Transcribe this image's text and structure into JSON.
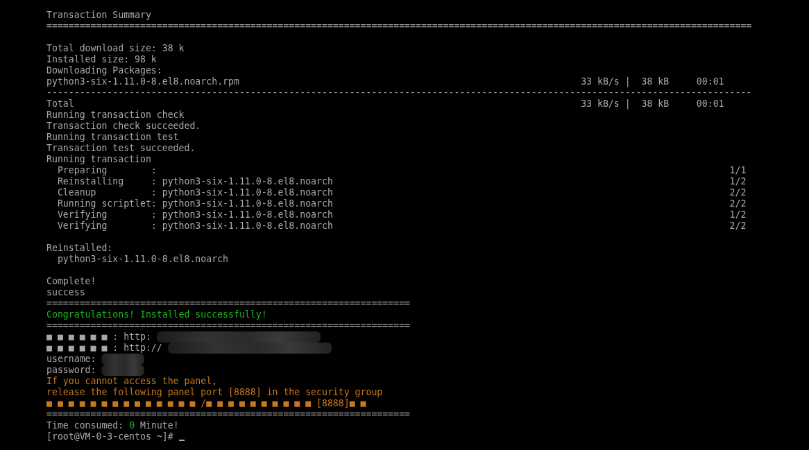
{
  "terminal": {
    "lines": [
      {
        "kind": "output",
        "segments": [
          {
            "kind": "text",
            "text": "Transaction Summary",
            "color": "#a8a8a8"
          }
        ]
      },
      {
        "kind": "output",
        "segments": [
          {
            "kind": "text",
            "text": "================================================================================================================================",
            "color": "#a8a8a8"
          }
        ]
      },
      {
        "kind": "blank"
      },
      {
        "kind": "output",
        "segments": [
          {
            "kind": "text",
            "text": "Total download size: 38 k",
            "color": "#a8a8a8"
          }
        ]
      },
      {
        "kind": "output",
        "segments": [
          {
            "kind": "text",
            "text": "Installed size: 98 k",
            "color": "#a8a8a8"
          }
        ]
      },
      {
        "kind": "output",
        "segments": [
          {
            "kind": "text",
            "text": "Downloading Packages:",
            "color": "#a8a8a8"
          }
        ]
      },
      {
        "kind": "output",
        "segments": [
          {
            "kind": "text",
            "text": "python3-six-1.11.0-8.el8.noarch.rpm                                                              33 kB/s |  38 kB     00:01",
            "color": "#a8a8a8"
          }
        ]
      },
      {
        "kind": "output",
        "segments": [
          {
            "kind": "text",
            "text": "--------------------------------------------------------------------------------------------------------------------------------",
            "color": "#a8a8a8"
          }
        ]
      },
      {
        "kind": "output",
        "segments": [
          {
            "kind": "text",
            "text": "Total                                                                                            33 kB/s |  38 kB     00:01",
            "color": "#a8a8a8"
          }
        ]
      },
      {
        "kind": "output",
        "segments": [
          {
            "kind": "text",
            "text": "Running transaction check",
            "color": "#a8a8a8"
          }
        ]
      },
      {
        "kind": "output",
        "segments": [
          {
            "kind": "text",
            "text": "Transaction check succeeded.",
            "color": "#a8a8a8"
          }
        ]
      },
      {
        "kind": "output",
        "segments": [
          {
            "kind": "text",
            "text": "Running transaction test",
            "color": "#a8a8a8"
          }
        ]
      },
      {
        "kind": "output",
        "segments": [
          {
            "kind": "text",
            "text": "Transaction test succeeded.",
            "color": "#a8a8a8"
          }
        ]
      },
      {
        "kind": "output",
        "segments": [
          {
            "kind": "text",
            "text": "Running transaction",
            "color": "#a8a8a8"
          }
        ]
      },
      {
        "kind": "output",
        "segments": [
          {
            "kind": "text",
            "text": "  Preparing        :                                                                                                        1/1",
            "color": "#a8a8a8"
          }
        ]
      },
      {
        "kind": "output",
        "segments": [
          {
            "kind": "text",
            "text": "  Reinstalling     : python3-six-1.11.0-8.el8.noarch                                                                        1/2",
            "color": "#a8a8a8"
          }
        ]
      },
      {
        "kind": "output",
        "segments": [
          {
            "kind": "text",
            "text": "  Cleanup          : python3-six-1.11.0-8.el8.noarch                                                                        2/2",
            "color": "#a8a8a8"
          }
        ]
      },
      {
        "kind": "output",
        "segments": [
          {
            "kind": "text",
            "text": "  Running scriptlet: python3-six-1.11.0-8.el8.noarch                                                                        2/2",
            "color": "#a8a8a8"
          }
        ]
      },
      {
        "kind": "output",
        "segments": [
          {
            "kind": "text",
            "text": "  Verifying        : python3-six-1.11.0-8.el8.noarch                                                                        1/2",
            "color": "#a8a8a8"
          }
        ]
      },
      {
        "kind": "output",
        "segments": [
          {
            "kind": "text",
            "text": "  Verifying        : python3-six-1.11.0-8.el8.noarch                                                                        2/2",
            "color": "#a8a8a8"
          }
        ]
      },
      {
        "kind": "blank"
      },
      {
        "kind": "output",
        "segments": [
          {
            "kind": "text",
            "text": "Reinstalled:",
            "color": "#a8a8a8"
          }
        ]
      },
      {
        "kind": "output",
        "segments": [
          {
            "kind": "text",
            "text": "  python3-six-1.11.0-8.el8.noarch",
            "color": "#a8a8a8"
          }
        ]
      },
      {
        "kind": "blank"
      },
      {
        "kind": "output",
        "segments": [
          {
            "kind": "text",
            "text": "Complete!",
            "color": "#a8a8a8"
          }
        ]
      },
      {
        "kind": "output",
        "segments": [
          {
            "kind": "text",
            "text": "success",
            "color": "#a8a8a8"
          }
        ]
      },
      {
        "kind": "output",
        "segments": [
          {
            "kind": "text",
            "text": "==================================================================",
            "color": "#a8a8a8"
          }
        ]
      },
      {
        "kind": "output",
        "segments": [
          {
            "kind": "text",
            "text": "Congratulations! Installed successfully!",
            "color": "#1cb81c"
          }
        ]
      },
      {
        "kind": "output",
        "segments": [
          {
            "kind": "text",
            "text": "==================================================================",
            "color": "#a8a8a8"
          }
        ]
      },
      {
        "kind": "output",
        "segments": [
          {
            "kind": "text",
            "text": "■ ■ ■ ■ ■ ■ : http:",
            "color": "#a8a8a8"
          },
          {
            "kind": "blur_wide"
          }
        ]
      },
      {
        "kind": "output",
        "segments": [
          {
            "kind": "text",
            "text": "■ ■ ■ ■ ■ ■ : http://",
            "color": "#a8a8a8"
          },
          {
            "kind": "blur_wide"
          }
        ]
      },
      {
        "kind": "output",
        "segments": [
          {
            "kind": "text",
            "text": "username:",
            "color": "#a8a8a8"
          },
          {
            "kind": "blur_narrow"
          }
        ]
      },
      {
        "kind": "output",
        "segments": [
          {
            "kind": "text",
            "text": "password:",
            "color": "#a8a8a8"
          },
          {
            "kind": "blur_narrow"
          }
        ]
      },
      {
        "kind": "output",
        "segments": [
          {
            "kind": "text",
            "text": "If you cannot access the panel,",
            "color": "#c8781e"
          }
        ]
      },
      {
        "kind": "output",
        "segments": [
          {
            "kind": "text",
            "text": "release the following panel port [8888] in the security group",
            "color": "#c8781e"
          }
        ]
      },
      {
        "kind": "output",
        "segments": [
          {
            "kind": "text",
            "text": "■ ■ ■ ■ ■ ■ ■ ■ ■ ■ ■ ■ ■ ■ /■ ■ ■ ■ ■ ■ ■ ■ ■ ■ [8888]■ ■",
            "color": "#c8781e"
          }
        ]
      },
      {
        "kind": "output",
        "segments": [
          {
            "kind": "text",
            "text": "==================================================================",
            "color": "#a8a8a8"
          }
        ]
      },
      {
        "kind": "output",
        "segments": [
          {
            "kind": "text",
            "text": "Time consumed:",
            "color": "#a8a8a8"
          },
          {
            "kind": "text",
            "text": "0",
            "color": "#1cb81c"
          },
          {
            "kind": "text",
            "text": "Minute!",
            "color": "#a8a8a8"
          }
        ]
      },
      {
        "kind": "output",
        "segments": [
          {
            "kind": "text",
            "text": "[root@VM-0-3-centos ~]#",
            "color": "#a8a8a8"
          },
          {
            "kind": "cursor",
            "color": "#a8a8a8"
          }
        ]
      }
    ]
  }
}
